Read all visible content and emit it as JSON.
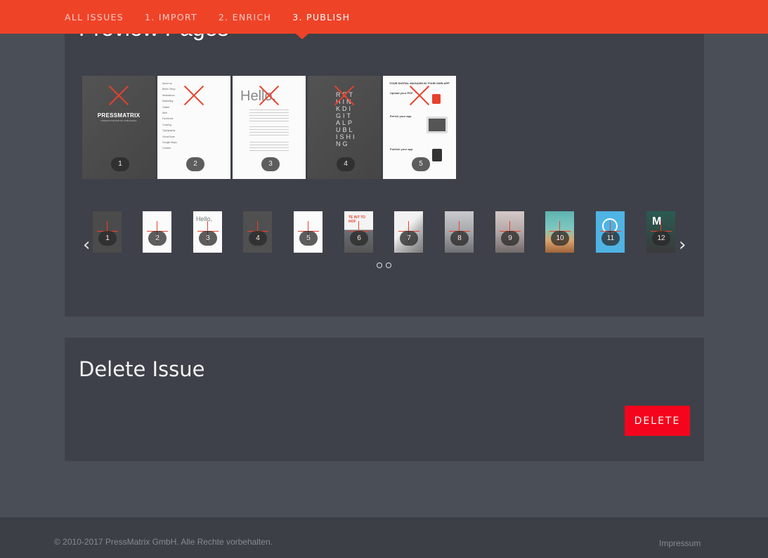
{
  "nav": {
    "items": [
      {
        "label": "ALL ISSUES"
      },
      {
        "label": "1. IMPORT"
      },
      {
        "label": "2. ENRICH"
      },
      {
        "label": "3. PUBLISH"
      }
    ],
    "active_index": 3
  },
  "preview": {
    "title": "Preview Pages",
    "pages": [
      {
        "number": "1",
        "brand": "PRESSMATRIX",
        "tagline": "INTERACTIVE DIGITAL PUBLISHING"
      },
      {
        "number": "2",
        "toc": [
          "About us",
          "Berlin Temp.",
          "Illustrations",
          "Marketing",
          "Twitter",
          "Web",
          "Facebook",
          "Cooking",
          "Typography",
          "Visual Note",
          "Google Maps",
          "Contact"
        ]
      },
      {
        "number": "3",
        "greeting": "Hello,"
      },
      {
        "number": "4",
        "headline": "RETHINKDIGITALPUBLISHING"
      },
      {
        "number": "5",
        "heading": "YOUR DIGITAL MAGAZIN IN YOUR OWN APP",
        "sections": [
          "Upload your PDF",
          "Enrich your app",
          "Publish your app"
        ]
      }
    ],
    "thumbnails": [
      "1",
      "2",
      "3",
      "4",
      "5",
      "6",
      "7",
      "8",
      "9",
      "10",
      "11",
      "12"
    ],
    "thumb_texts": {
      "t3": "Hello,",
      "t6": "TE INT TO HOF"
    }
  },
  "delete": {
    "title": "Delete Issue",
    "button_label": "DELETE"
  },
  "footer": {
    "copyright": "© 2010-2017 PressMatrix GmbH. Alle Rechte vorbehalten.",
    "impressum": "Impressum"
  },
  "colors": {
    "accent": "#ef4328",
    "delete_button": "#f5051d",
    "panel": "#3e4149",
    "background": "#4a4e57"
  }
}
